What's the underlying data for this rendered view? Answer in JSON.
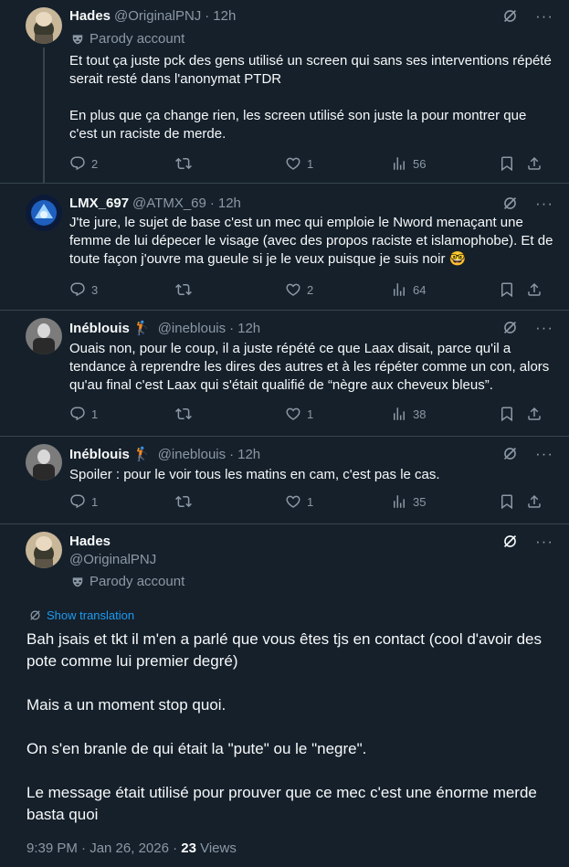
{
  "replies": [
    {
      "name": "Hades",
      "handle": "@OriginalPNJ",
      "time": "12h",
      "parody": "Parody account",
      "text": "Et tout ça juste pck des gens utilisé un screen qui sans ses interventions répété serait resté dans l'anonymat PTDR\n\nEn plus que ça change rien, les screen utilisé son juste la pour montrer que c'est un raciste de merde.",
      "replies": "2",
      "likes": "1",
      "views": "56"
    },
    {
      "name": "LMX_697",
      "handle": "@ATMX_69",
      "time": "12h",
      "text": "J'te jure, le sujet de base c'est un mec qui emploie le Nword menaçant une femme de lui dépecer le visage (avec des propos raciste et islamophobe). Et de toute façon j'ouvre ma gueule si je le veux puisque je suis noir 🤓",
      "replies": "3",
      "likes": "2",
      "views": "64"
    },
    {
      "name": "Inéblouis 🏌",
      "handle": "@ineblouis",
      "time": "12h",
      "text": "Ouais non, pour le coup, il a juste répété ce que Laax disait, parce qu'il a tendance à reprendre les dires des autres et à les répéter comme un con, alors qu'au final c'est Laax qui s'était qualifié de “nègre aux cheveux bleus”.",
      "replies": "1",
      "likes": "1",
      "views": "38"
    },
    {
      "name": "Inéblouis 🏌",
      "handle": "@ineblouis",
      "time": "12h",
      "text": "Spoiler : pour le voir tous les matins en cam, c'est pas le cas.",
      "replies": "1",
      "likes": "1",
      "views": "35"
    }
  ],
  "main": {
    "name": "Hades",
    "handle": "@OriginalPNJ",
    "parody": "Parody account",
    "show_translation": "Show translation",
    "text": "Bah jsais et tkt il m'en a parlé que vous êtes tjs en contact (cool d'avoir des pote comme lui premier degré)\n\nMais a un moment stop quoi.\n\nOn s'en branle de qui était la \"pute\" ou le \"negre\".\n\nLe message était utilisé pour prouver que ce mec c'est une énorme merde basta quoi",
    "timestamp": "9:39 PM · Jan 26, 2026 · ",
    "views_count": "23",
    "views_label": " Views"
  },
  "colors": {
    "bg": "#15202b",
    "text": "#f7f9f9",
    "muted": "#8b98a5",
    "link": "#1d9bf0",
    "border": "#38444d"
  }
}
